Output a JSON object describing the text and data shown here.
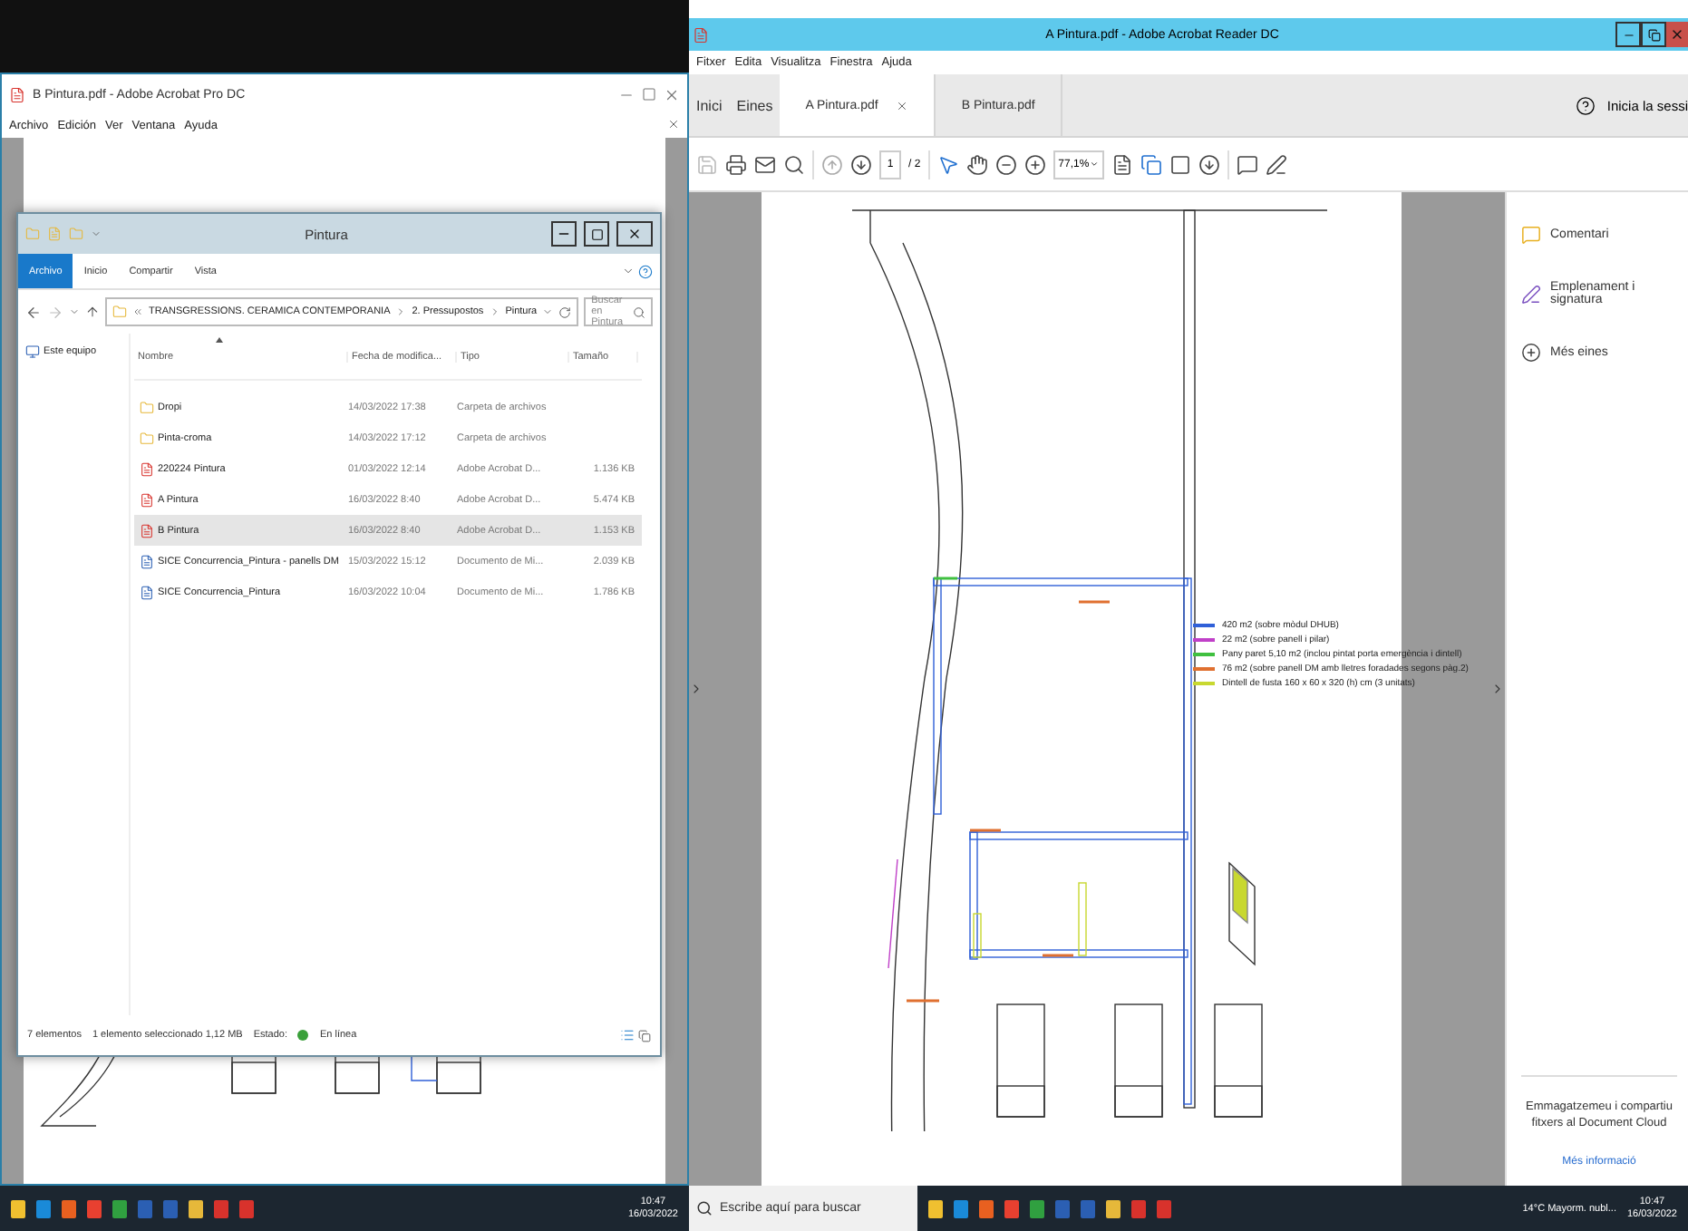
{
  "left_screen": {
    "acrobat_pro": {
      "title": "B Pintura.pdf - Adobe Acrobat Pro DC",
      "menu": [
        "Archivo",
        "Edición",
        "Ver",
        "Ventana",
        "Ayuda"
      ]
    },
    "explorer": {
      "title": "Pintura",
      "ribbon_tabs": [
        {
          "label": "Archivo",
          "selected": true
        },
        {
          "label": "Inicio",
          "selected": false
        },
        {
          "label": "Compartir",
          "selected": false
        },
        {
          "label": "Vista",
          "selected": false
        }
      ],
      "path": [
        "TRANSGRESSIONS. CERAMICA CONTEMPORANIA",
        "2. Pressupostos",
        "Pintura"
      ],
      "search": {
        "placeholder": "Buscar en Pintura"
      },
      "nav": [
        "Este equipo"
      ],
      "columns": [
        "Nombre",
        "Fecha de modifica...",
        "Tipo",
        "Tamaño"
      ],
      "files": [
        {
          "kind": "folder",
          "name": "Dropi",
          "date": "14/03/2022 17:38",
          "type": "Carpeta de archivos",
          "selected": false
        },
        {
          "kind": "folder",
          "name": "Pinta-croma",
          "date": "14/03/2022 17:12",
          "type": "Carpeta de archivos",
          "selected": false
        },
        {
          "kind": "pdf",
          "name": "220224 Pintura",
          "date": "01/03/2022 12:14",
          "type": "Adobe Acrobat D...",
          "size": "1.136 KB",
          "selected": false
        },
        {
          "kind": "pdf",
          "name": "A Pintura",
          "date": "16/03/2022 8:40",
          "type": "Adobe Acrobat D...",
          "size": "5.474 KB",
          "selected": false
        },
        {
          "kind": "pdf",
          "name": "B Pintura",
          "date": "16/03/2022 8:40",
          "type": "Adobe Acrobat D...",
          "size": "1.153 KB",
          "selected": true
        },
        {
          "kind": "doc",
          "name": "SICE Concurrencia_Pintura - panells DM",
          "date": "15/03/2022 15:12",
          "type": "Documento de Mi...",
          "size": "2.039 KB",
          "selected": false
        },
        {
          "kind": "doc",
          "name": "SICE Concurrencia_Pintura",
          "date": "16/03/2022 10:04",
          "type": "Documento de Mi...",
          "size": "1.786 KB",
          "selected": false
        }
      ],
      "status": {
        "count": "7 elementos",
        "selection": "1 elemento seleccionado  1,12 MB",
        "state_label": "Estado:",
        "state": "En línea"
      }
    },
    "taskbar": {
      "time": "10:47",
      "date": "16/03/2022"
    }
  },
  "right_screen": {
    "title": "A Pintura.pdf - Adobe Acrobat Reader DC",
    "menu": [
      "Fitxer",
      "Edita",
      "Visualitza",
      "Finestra",
      "Ajuda"
    ],
    "nav": [
      "Inici",
      "Eines"
    ],
    "tabs": [
      {
        "label": "A Pintura.pdf",
        "selected": true
      },
      {
        "label": "B Pintura.pdf",
        "selected": false
      }
    ],
    "sign_in": "Inicia la sessi",
    "toolbar": {
      "page": "1",
      "pages": "/ 2",
      "zoom": "77,1%"
    },
    "legend": [
      {
        "label": "420 m2 (sobre mòdul DHUB)",
        "color": "#3060d8"
      },
      {
        "label": "22 m2 (sobre panell i pilar)",
        "color": "#c040c8"
      },
      {
        "label": "Pany paret 5,10 m2 (inclou pintat porta emergència i dintell)",
        "color": "#40c040"
      },
      {
        "label": "76 m2 (sobre panell DM amb lletres foradades segons pàg.2)",
        "color": "#e07030"
      },
      {
        "label": "Dintell de fusta 160 x 60 x 320 (h) cm (3 unitats)",
        "color": "#c8d830"
      }
    ],
    "tools": [
      {
        "kind": "comment",
        "label": "Comentari"
      },
      {
        "kind": "sign",
        "label": "Emplenament i signatura"
      },
      {
        "kind": "more",
        "label": "Més eines"
      }
    ],
    "cloud": {
      "text": "Emmagatzemeu i compartiu fitxers al Document Cloud",
      "link": "Més informació"
    },
    "taskbar": {
      "search": {
        "placeholder": "Escribe aquí para buscar"
      },
      "weather": "14°C  Mayorm. nubl...",
      "time": "10:47",
      "date": "16/03/2022"
    }
  }
}
